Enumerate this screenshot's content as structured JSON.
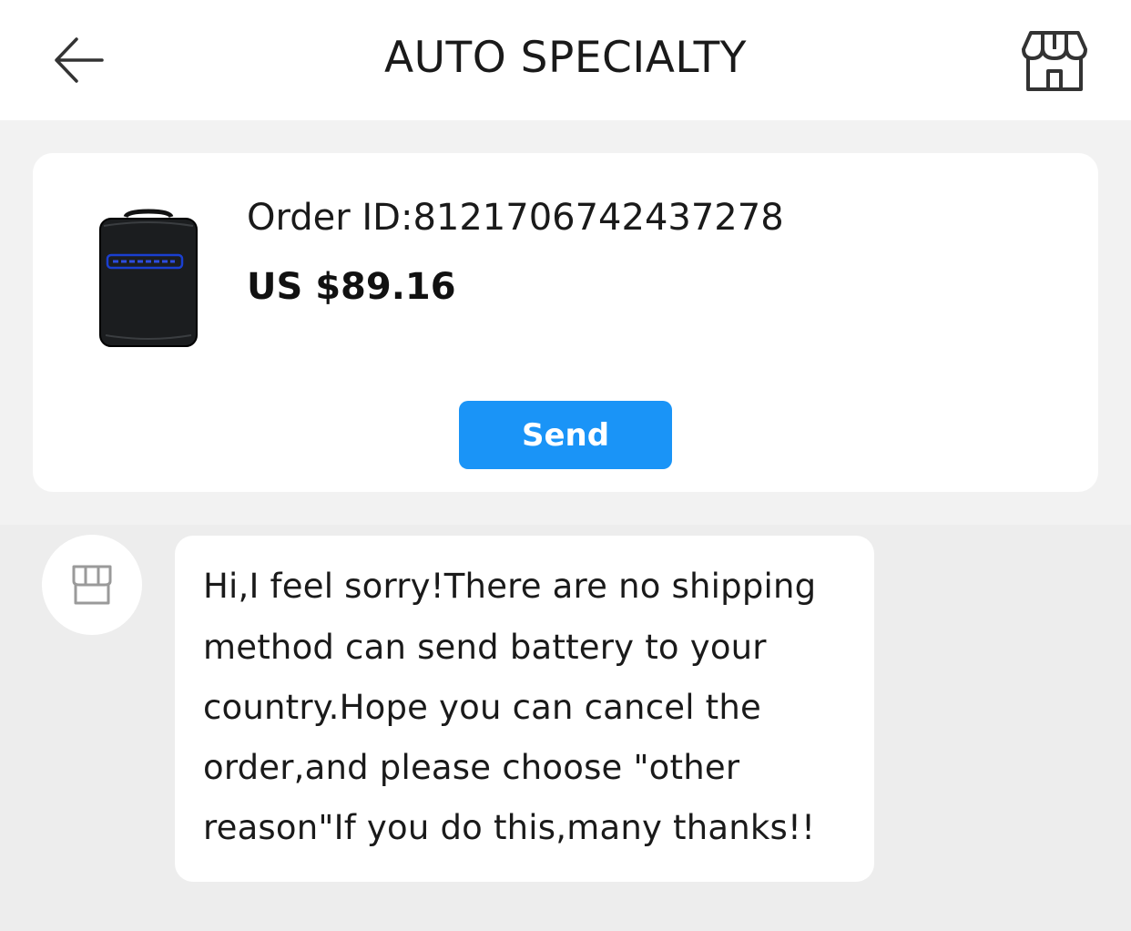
{
  "header": {
    "title": "AUTO SPECIALTY",
    "back_icon": "arrow-left-icon",
    "store_icon": "storefront-icon"
  },
  "order": {
    "id_text": "Order ID:8121706742437278",
    "price": "US $89.16",
    "send_label": "Send",
    "product_image": "black-carrying-case-image"
  },
  "message": {
    "sender_icon": "storefront-icon",
    "lines": [
      "Hi,I feel sorry!There are no shipping",
      "method can send battery to your",
      "country.Hope you can cancel the",
      "order,and please choose \"other",
      "reason\"If you do this,many thanks!!"
    ]
  },
  "colors": {
    "accent": "#1a94f7",
    "background": "#ededed",
    "card": "#ffffff"
  }
}
